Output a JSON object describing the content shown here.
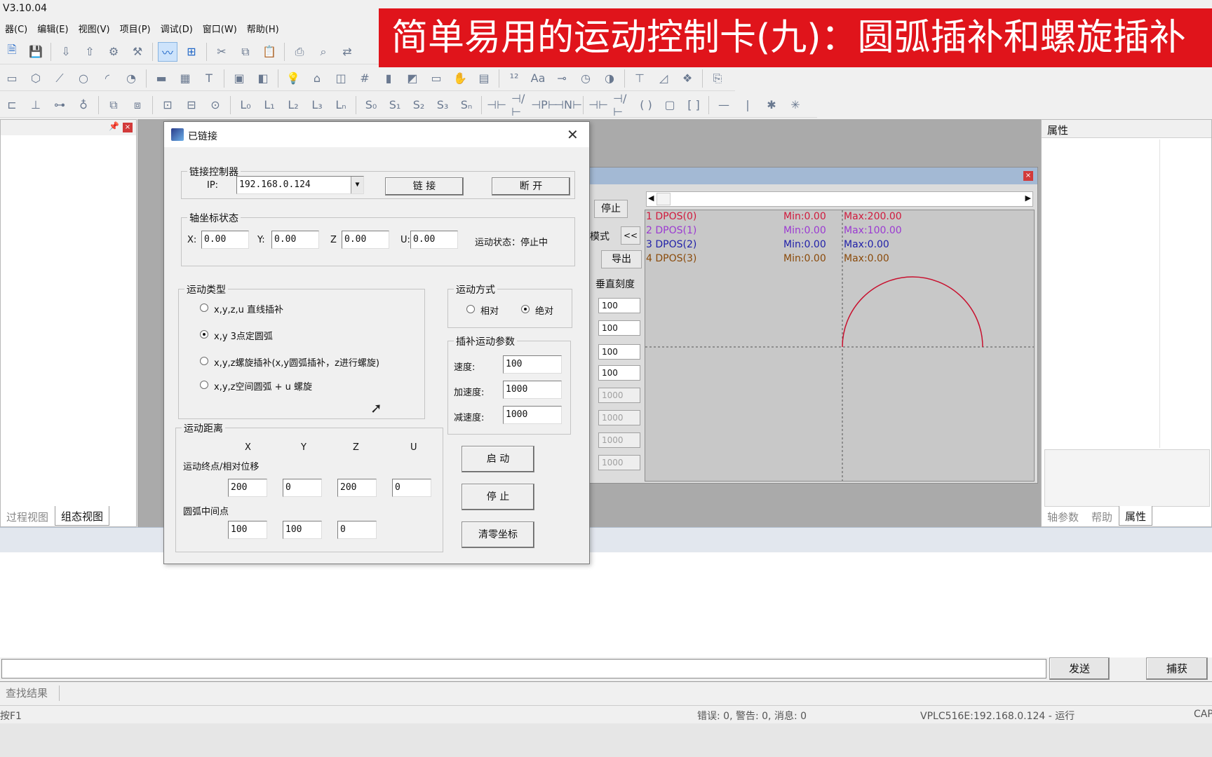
{
  "app": {
    "version": "V3.10.04"
  },
  "banner": {
    "text": "简单易用的运动控制卡(九)：圆弧插补和螺旋插补"
  },
  "menubar": [
    "器(C)",
    "编辑(E)",
    "视图(V)",
    "项目(P)",
    "调试(D)",
    "窗口(W)",
    "帮助(H)"
  ],
  "left_panel": {
    "tabs": [
      {
        "label": "过程视图",
        "active": false
      },
      {
        "label": "组态视图",
        "active": true
      }
    ]
  },
  "right_panel": {
    "title": "属性",
    "tabs": [
      {
        "label": "轴参数",
        "active": false
      },
      {
        "label": "帮助",
        "active": false
      },
      {
        "label": "属性",
        "active": true
      }
    ]
  },
  "scope": {
    "stop_label": "停止",
    "mode_label": "模式",
    "collapse_label": "<<",
    "export_label": "导出",
    "vscale_label": "垂直刻度",
    "vscale_values": [
      "100",
      "100",
      "100",
      "100"
    ],
    "vscale_disabled": [
      "1000",
      "1000",
      "1000",
      "1000"
    ],
    "legend": [
      {
        "name": "1 DPOS(0)",
        "min": "Min:0.00",
        "max": "Max:200.00",
        "color": "#d01a3c"
      },
      {
        "name": "2 DPOS(1)",
        "min": "Min:0.00",
        "max": "Max:100.00",
        "color": "#9b3ad1"
      },
      {
        "name": "3 DPOS(2)",
        "min": "Min:0.00",
        "max": "Max:0.00",
        "color": "#1f1fa8"
      },
      {
        "name": "4 DPOS(3)",
        "min": "Min:0.00",
        "max": "Max:0.00",
        "color": "#8a4a0a"
      }
    ],
    "trace_color": "#c8102e"
  },
  "dialog": {
    "title": "已链接",
    "connect_group": {
      "label": "链接控制器",
      "ip_label": "IP:",
      "ip_value": "192.168.0.124",
      "connect_button": "链 接",
      "disconnect_button": "断 开"
    },
    "coord_group": {
      "label": "轴坐标状态",
      "x_label": "X:",
      "x_value": "0.00",
      "y_label": "Y:",
      "y_value": "0.00",
      "z_label": "Z",
      "z_value": "0.00",
      "u_label": "U:",
      "u_value": "0.00",
      "status_text": "运动状态：停止中"
    },
    "motion_type": {
      "label": "运动类型",
      "options": [
        {
          "label": "x,y,z,u  直线插补",
          "checked": false
        },
        {
          "label": "x,y 3点定圆弧",
          "checked": true
        },
        {
          "label": "x,y,z螺旋插补(x,y圆弧插补，z进行螺旋)",
          "checked": false
        },
        {
          "label": "x,y,z空间圆弧 + u 螺旋",
          "checked": false
        }
      ]
    },
    "motion_mode": {
      "label": "运动方式",
      "options": [
        {
          "label": "相对",
          "checked": false
        },
        {
          "label": "绝对",
          "checked": true
        }
      ]
    },
    "interp_params": {
      "label": "插补运动参数",
      "speed_label": "速度:",
      "speed_value": "100",
      "accel_label": "加速度:",
      "accel_value": "1000",
      "decel_label": "减速度:",
      "decel_value": "1000"
    },
    "distance": {
      "label": "运动距离",
      "axes": [
        "X",
        "Y",
        "Z",
        "U"
      ],
      "endpoint_label": "运动终点/相对位移",
      "endpoint_values": [
        "200",
        "0",
        "200",
        "0"
      ],
      "mid_label": "圆弧中间点",
      "mid_values": [
        "100",
        "100",
        "0"
      ]
    },
    "buttons": {
      "start": "启 动",
      "stop": "停 止",
      "zero": "清零坐标"
    }
  },
  "bottom": {
    "send_label": "发送",
    "capture_label": "捕获",
    "find_tab": "查找结果"
  },
  "statusbar": {
    "help_hint": "按F1",
    "messages": "错误: 0, 警告: 0, 消息: 0",
    "connection": "VPLC516E:192.168.0.124 - 运行",
    "caps": "CAP"
  }
}
